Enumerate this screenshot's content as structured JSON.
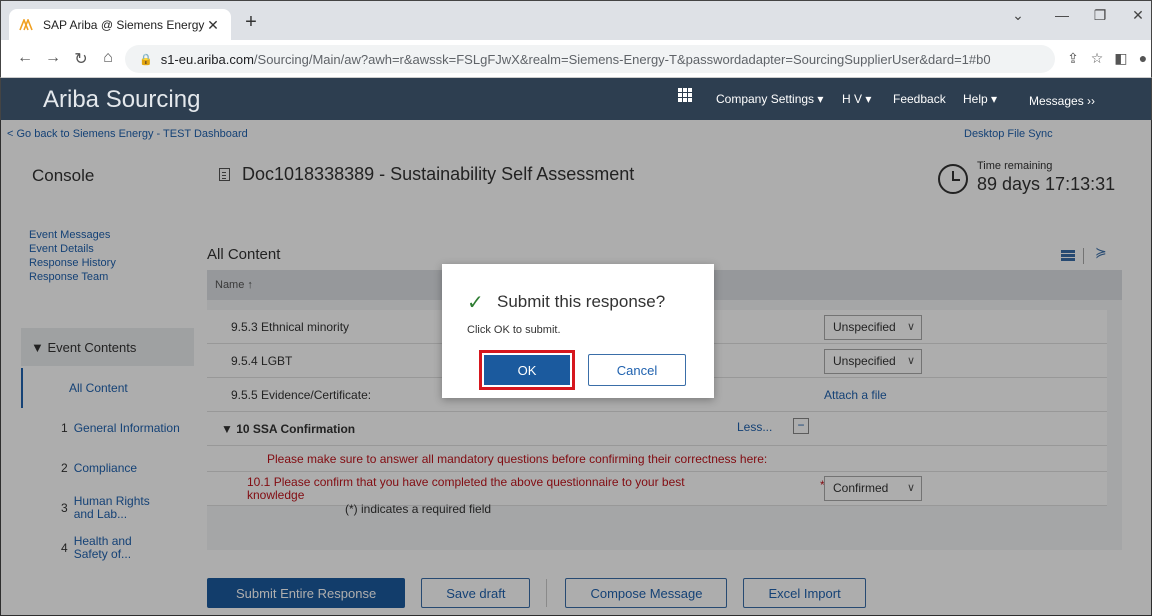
{
  "browser": {
    "tab_title": "SAP Ariba @ Siemens Energy",
    "url_domain": "s1-eu.ariba.com",
    "url_path": "/Sourcing/Main/aw?awh=r&awssk=FSLgFJwX&realm=Siemens-Energy-T&passwordadapter=SourcingSupplierUser&dard=1#b0"
  },
  "header": {
    "logo": "Ariba Sourcing",
    "company_settings": "Company Settings ▾",
    "user": "H V ▾",
    "feedback": "Feedback",
    "help": "Help ▾",
    "messages": "Messages ››"
  },
  "page": {
    "back_link": "< Go back to Siemens Energy - TEST Dashboard",
    "desktop_sync": "Desktop File Sync",
    "console": "Console",
    "doc_title": "Doc1018338389 - Sustainability Self Assessment",
    "time_label": "Time remaining",
    "time_value": "89 days 17:13:31"
  },
  "sidebar": {
    "links": [
      "Event Messages",
      "Event Details",
      "Response History",
      "Response Team"
    ],
    "contents_header": "▼ Event Contents",
    "items": [
      {
        "num": "",
        "label": "All Content"
      },
      {
        "num": "1",
        "label": "General Information"
      },
      {
        "num": "2",
        "label": "Compliance"
      },
      {
        "num": "3",
        "label": "Human Rights and Lab..."
      },
      {
        "num": "4",
        "label": "Health and Safety of..."
      }
    ]
  },
  "content": {
    "title": "All Content",
    "column_name": "Name ↑",
    "rows": [
      {
        "label": "9.5.3  Ethnical minority",
        "value": "Unspecified"
      },
      {
        "label": "9.5.4  LGBT",
        "value": "Unspecified"
      },
      {
        "label": "9.5.5  Evidence/Certificate:",
        "value": "Attach a file"
      }
    ],
    "section": "▼ 10  SSA Confirmation",
    "less": "Less...",
    "less_btn": "−",
    "warning": "Please make sure to answer all mandatory questions before confirming their correctness here:",
    "q101": "10.1  Please confirm that you have completed the above questionnaire to your best knowledge",
    "q101_value": "Confirmed",
    "required_note": "(*) indicates a required field"
  },
  "buttons": {
    "submit": "Submit Entire Response",
    "save": "Save draft",
    "compose": "Compose Message",
    "excel": "Excel Import"
  },
  "modal": {
    "title": "Submit this response?",
    "message": "Click OK to submit.",
    "ok": "OK",
    "cancel": "Cancel"
  }
}
